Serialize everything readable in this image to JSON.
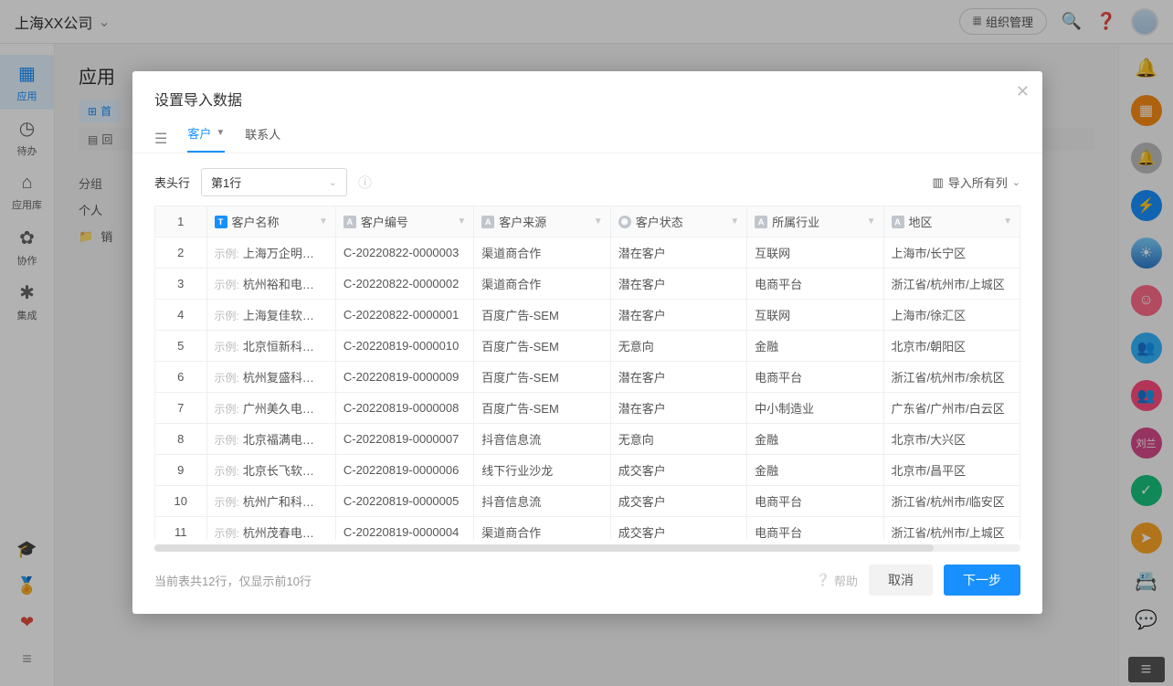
{
  "topbar": {
    "company": "上海XX公司",
    "org_button": "组织管理"
  },
  "sidebar": {
    "items": [
      {
        "label": "应用",
        "icon": "▦"
      },
      {
        "label": "待办",
        "icon": "◷"
      },
      {
        "label": "应用库",
        "icon": "⌂"
      },
      {
        "label": "协作",
        "icon": "✿"
      },
      {
        "label": "集成",
        "icon": "✱"
      }
    ]
  },
  "page": {
    "title": "应用",
    "tab_home": "首",
    "tab_back": "回",
    "groups_label": "分组",
    "group_personal": "个人",
    "group_sales": "销"
  },
  "modal": {
    "title": "设置导入数据",
    "tabs": {
      "customer": "客户",
      "contact": "联系人"
    },
    "header_row_label": "表头行",
    "header_row_value": "第1行",
    "import_all": "导入所有列",
    "columns": [
      {
        "label": "客户名称",
        "icon": "T"
      },
      {
        "label": "客户编号",
        "icon": "A"
      },
      {
        "label": "客户来源",
        "icon": "A"
      },
      {
        "label": "客户状态",
        "icon": "O"
      },
      {
        "label": "所属行业",
        "icon": "A"
      },
      {
        "label": "地区",
        "icon": "A"
      }
    ],
    "ex": "示例:",
    "rows": [
      {
        "n": "2",
        "name": "上海万企明…",
        "code": "C-20220822-0000003",
        "src": "渠道商合作",
        "status": "潜在客户",
        "ind": "互联网",
        "region": "上海市/长宁区"
      },
      {
        "n": "3",
        "name": "杭州裕和电…",
        "code": "C-20220822-0000002",
        "src": "渠道商合作",
        "status": "潜在客户",
        "ind": "电商平台",
        "region": "浙江省/杭州市/上城区"
      },
      {
        "n": "4",
        "name": "上海复佳软…",
        "code": "C-20220822-0000001",
        "src": "百度广告-SEM",
        "status": "潜在客户",
        "ind": "互联网",
        "region": "上海市/徐汇区"
      },
      {
        "n": "5",
        "name": "北京恒新科…",
        "code": "C-20220819-0000010",
        "src": "百度广告-SEM",
        "status": "无意向",
        "ind": "金融",
        "region": "北京市/朝阳区"
      },
      {
        "n": "6",
        "name": "杭州复盛科…",
        "code": "C-20220819-0000009",
        "src": "百度广告-SEM",
        "status": "潜在客户",
        "ind": "电商平台",
        "region": "浙江省/杭州市/余杭区"
      },
      {
        "n": "7",
        "name": "广州美久电…",
        "code": "C-20220819-0000008",
        "src": "百度广告-SEM",
        "status": "潜在客户",
        "ind": "中小制造业",
        "region": "广东省/广州市/白云区"
      },
      {
        "n": "8",
        "name": "北京福满电…",
        "code": "C-20220819-0000007",
        "src": "抖音信息流",
        "status": "无意向",
        "ind": "金融",
        "region": "北京市/大兴区"
      },
      {
        "n": "9",
        "name": "北京长飞软…",
        "code": "C-20220819-0000006",
        "src": "线下行业沙龙",
        "status": "成交客户",
        "ind": "金融",
        "region": "北京市/昌平区"
      },
      {
        "n": "10",
        "name": "杭州广和科…",
        "code": "C-20220819-0000005",
        "src": "抖音信息流",
        "status": "成交客户",
        "ind": "电商平台",
        "region": "浙江省/杭州市/临安区"
      },
      {
        "n": "11",
        "name": "杭州茂春电…",
        "code": "C-20220819-0000004",
        "src": "渠道商合作",
        "status": "成交客户",
        "ind": "电商平台",
        "region": "浙江省/杭州市/上城区"
      }
    ],
    "footer_status": "当前表共12行，仅显示前10行",
    "help": "帮助",
    "cancel": "取消",
    "next": "下一步"
  },
  "dock": {
    "user_initials": "刘兰"
  }
}
